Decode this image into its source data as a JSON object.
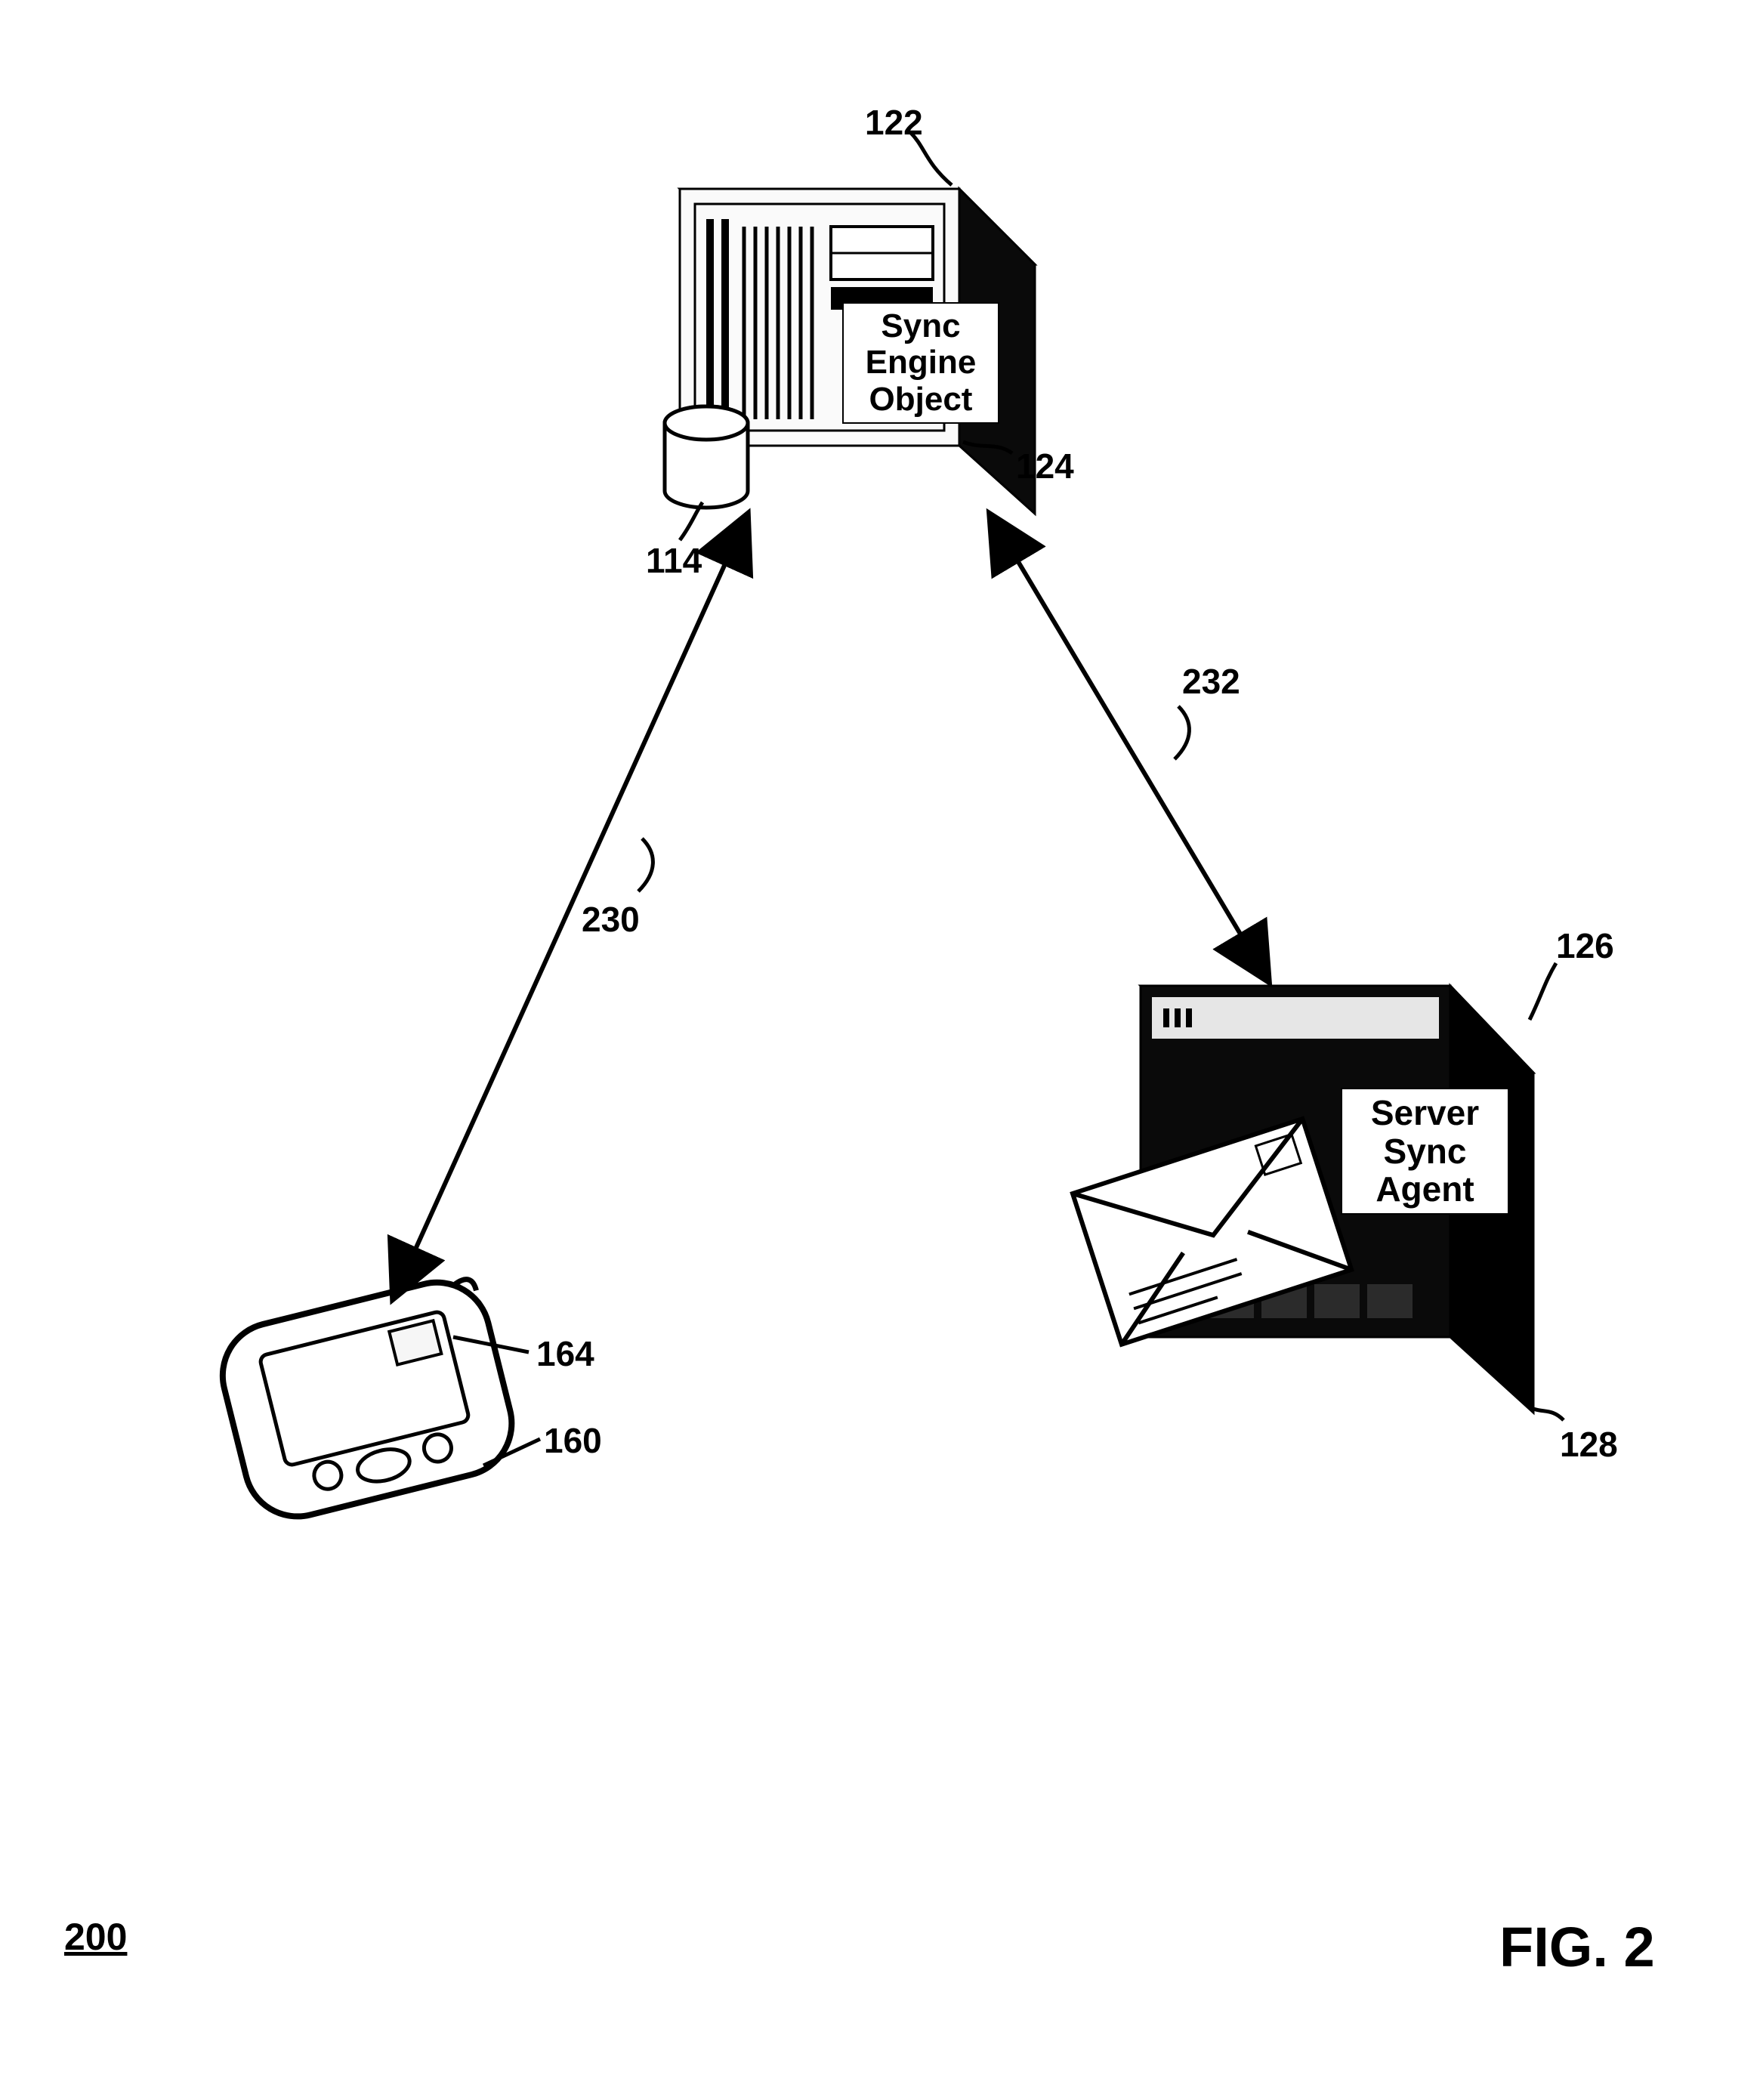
{
  "figure_number_underlined": "200",
  "figure_caption": "FIG. 2",
  "sync_engine": {
    "line1": "Sync",
    "line2": "Engine",
    "line3": "Object",
    "ref_box": "122",
    "ref_corner": "124",
    "ref_cylinder": "114"
  },
  "email_server": {
    "line1": "Server",
    "line2": "Sync",
    "line3": "Agent",
    "ref_box": "126",
    "ref_corner": "128"
  },
  "handheld": {
    "ref_device": "160",
    "ref_module": "164"
  },
  "arrows": {
    "left_ref": "230",
    "right_ref": "232"
  }
}
